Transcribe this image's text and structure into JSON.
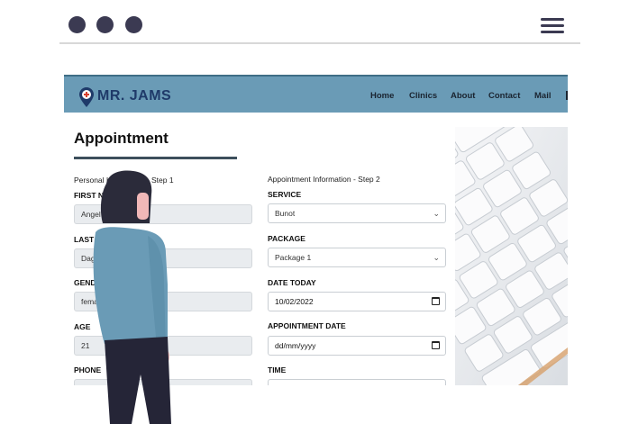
{
  "window": {
    "dots": [
      "dot",
      "dot",
      "dot"
    ],
    "menu_icon": "hamburger-menu-icon"
  },
  "header": {
    "logo_text": "MR. JAMS",
    "nav": [
      "Home",
      "Clinics",
      "About",
      "Contact",
      "Mail"
    ]
  },
  "main": {
    "title": "Appointment",
    "personal": {
      "step_label": "Personal Information - Step 1",
      "fields": [
        {
          "label": "FIRST NAME",
          "value": "Angel"
        },
        {
          "label": "LAST NAME",
          "value": "Dagohoy"
        },
        {
          "label": "GENDER",
          "value": "female"
        },
        {
          "label": "AGE",
          "value": "21"
        },
        {
          "label": "PHONE",
          "value": ""
        }
      ]
    },
    "appointment": {
      "step_label": "Appointment Information - Step 2",
      "service_label": "SERVICE",
      "service_value": "Bunot",
      "package_label": "PACKAGE",
      "package_value": "Package 1",
      "date_today_label": "DATE TODAY",
      "date_today_value": "10/02/2022",
      "appt_date_label": "APPOINTMENT DATE",
      "appt_date_value": "dd/mm/yyyy",
      "time_label": "TIME"
    }
  },
  "colors": {
    "navbar": "#6a9bb6",
    "dots": "#3b3a52",
    "accent_dark": "#3d4f5c"
  }
}
